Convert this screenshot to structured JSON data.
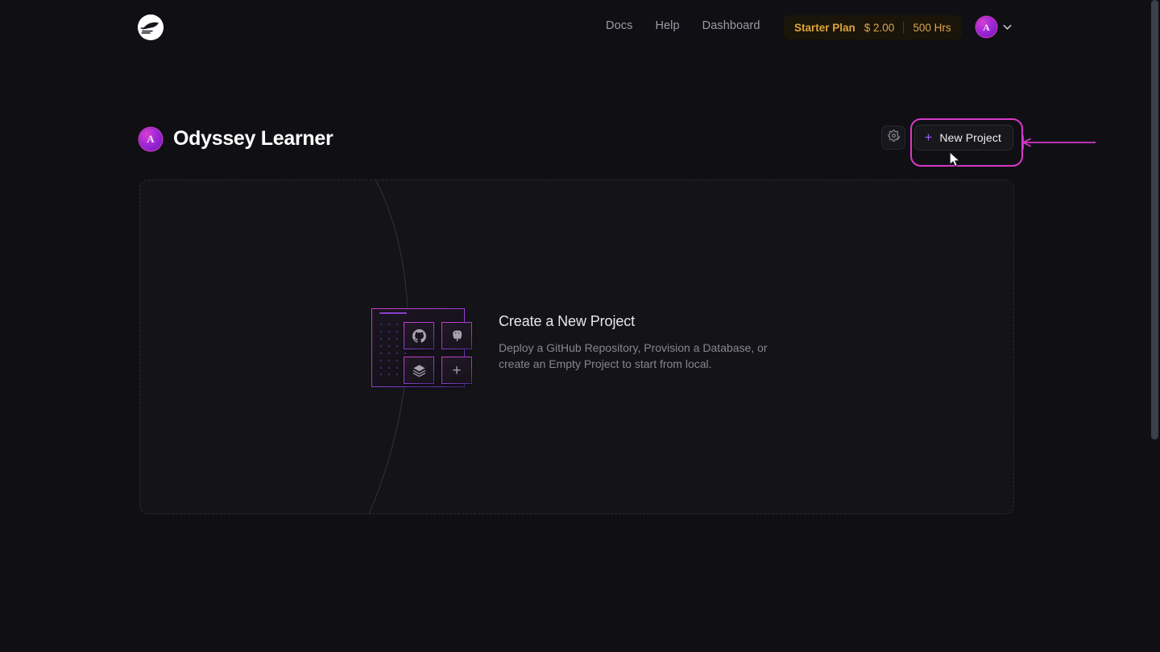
{
  "app": {
    "background_color": "#101014",
    "accent_purple": "#9a5cf5",
    "annotation_color": "#d838c8",
    "brand_logo_icon": "train-logo-icon"
  },
  "topnav": {
    "links": [
      {
        "label": "Docs",
        "name": "nav-link-docs"
      },
      {
        "label": "Help",
        "name": "nav-link-help"
      },
      {
        "label": "Dashboard",
        "name": "nav-link-dashboard"
      }
    ],
    "plan_badge": {
      "plan_name": "Starter Plan",
      "price": "$ 2.00",
      "hours": "500 Hrs",
      "text_color": "#e0a43c",
      "background_color": "#1b1509"
    },
    "account": {
      "avatar_letter": "A",
      "avatar_gradient": "#d83fd0 to #6d18bb",
      "chevron_icon": "chevron-down-icon"
    }
  },
  "page_header": {
    "title": "Odyssey Learner",
    "avatar_letter": "A",
    "settings_icon": "gear-icon",
    "new_project": {
      "label": "New Project",
      "plus_icon": "plus-icon"
    }
  },
  "annotation": {
    "highlight_target": "new-project-button",
    "arrow_direction": "left",
    "color": "#d838c8"
  },
  "empty_state": {
    "title": "Create a New Project",
    "description": "Deploy a GitHub Repository, Provision a Database, or create an Empty Project to start from local.",
    "illustration": {
      "tiles": [
        {
          "name": "github-icon",
          "label": "GitHub"
        },
        {
          "name": "postgres-icon",
          "label": "PostgreSQL"
        },
        {
          "name": "stack-icon",
          "label": "Stack"
        },
        {
          "name": "plus-icon",
          "label": "+"
        }
      ]
    }
  },
  "scrollbar": {
    "thumb_color": "#3b4149",
    "position": "top"
  }
}
